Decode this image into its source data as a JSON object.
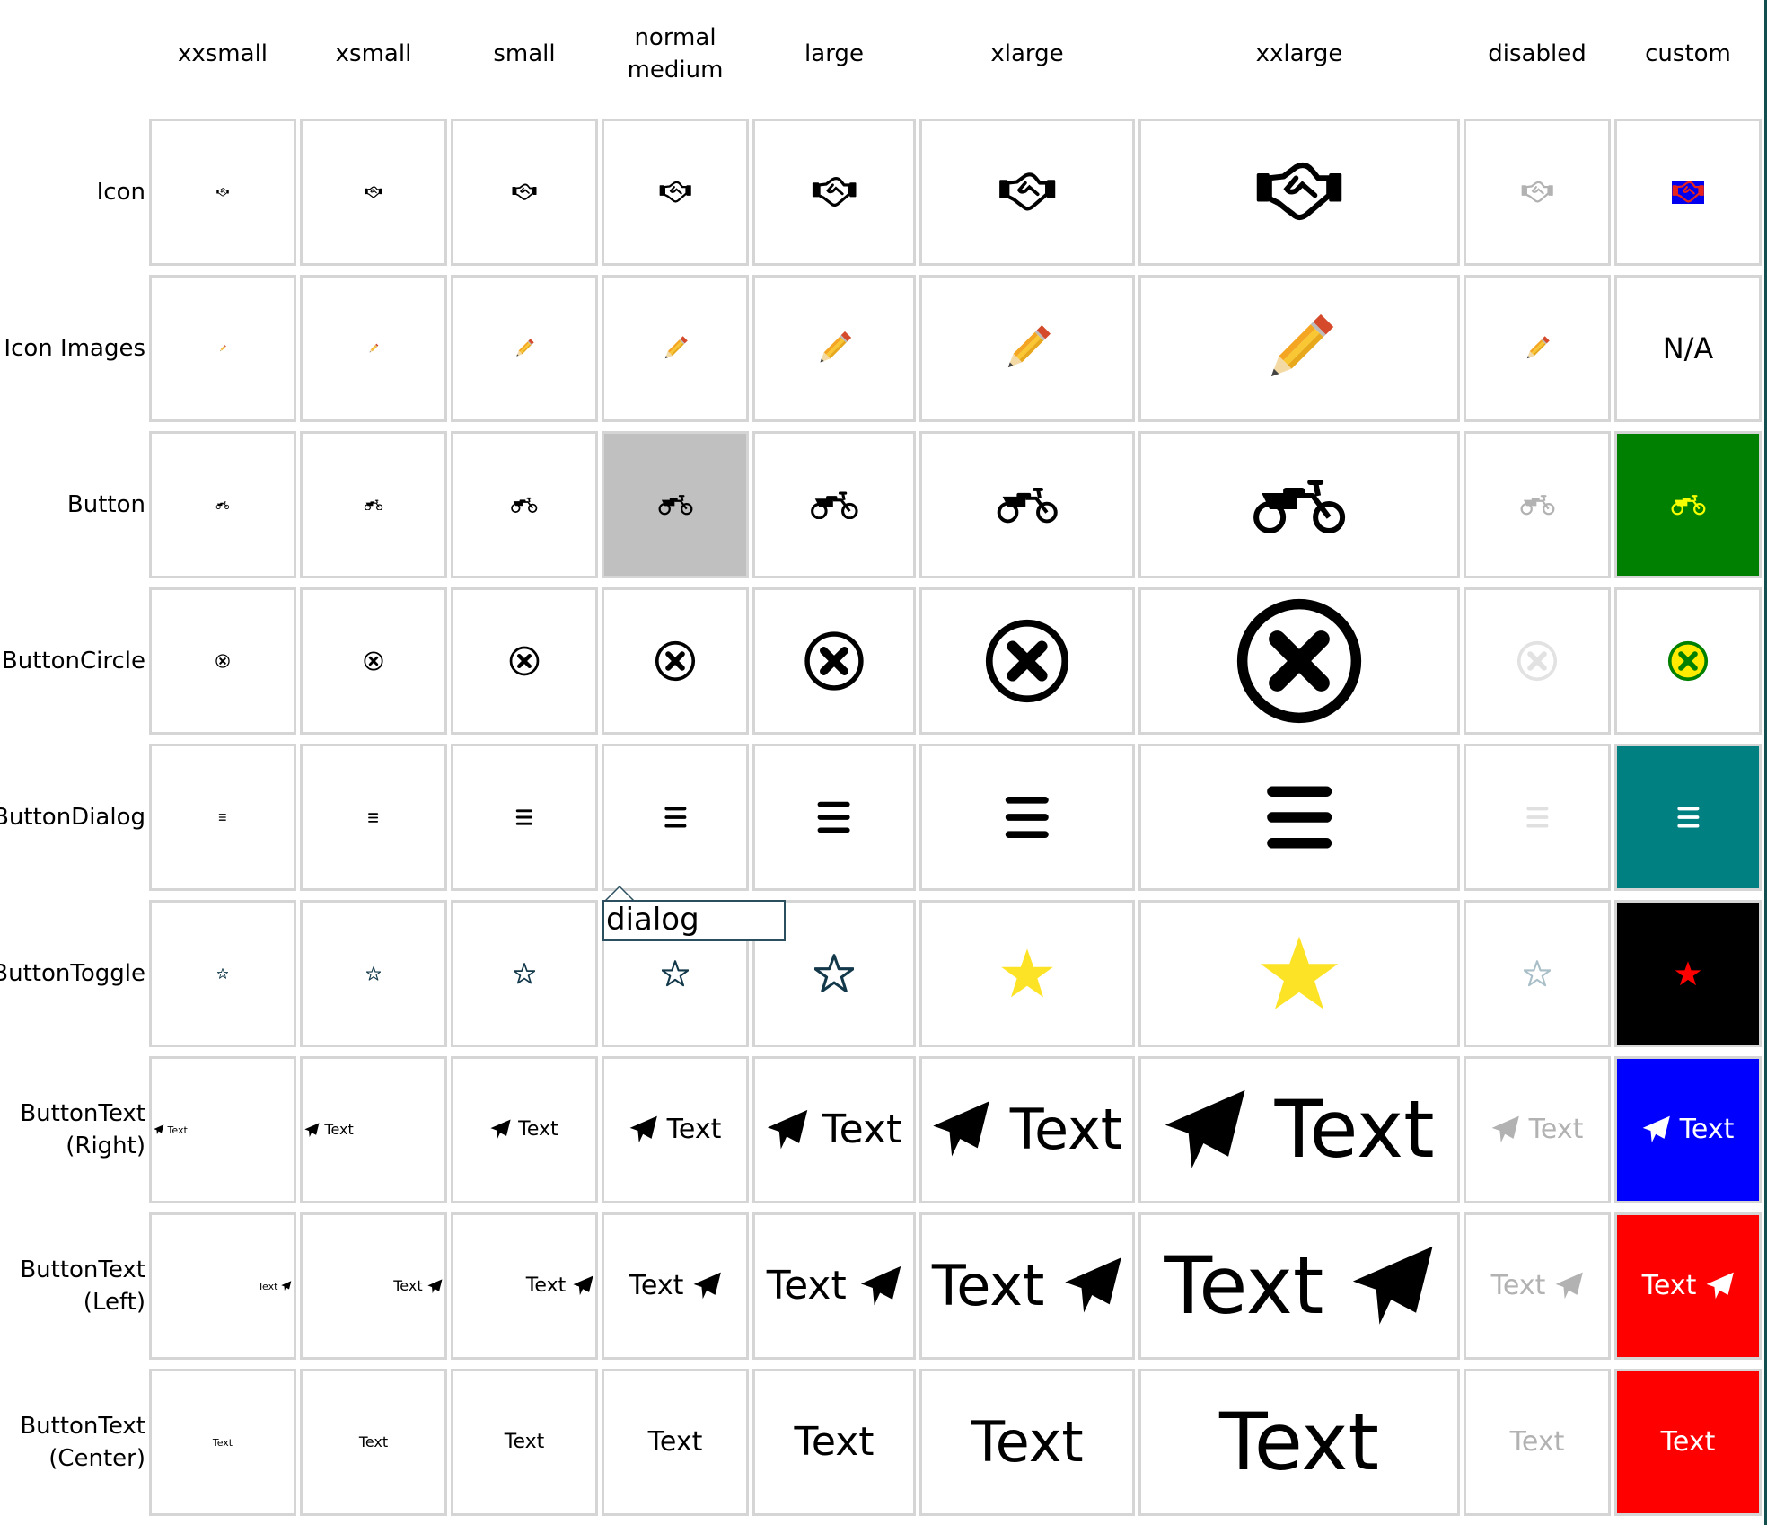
{
  "columns": [
    "xxsmall",
    "xsmall",
    "small",
    "normal\nmedium",
    "large",
    "xlarge",
    "xxlarge",
    "disabled",
    "custom"
  ],
  "rows": [
    "Icon",
    "Icon Images",
    "Button",
    "ButtonCircle",
    "ButtonDialog",
    "ButtonToggle",
    "ButtonText\n(Right)",
    "ButtonText\n(Left)",
    "ButtonText\n(Center)"
  ],
  "icon_names": {
    "Icon": "handshake-icon",
    "Icon Images": "pencil-icon",
    "Button": "motorcycle-icon",
    "ButtonCircle": "close-circle-icon",
    "ButtonDialog": "menu-icon",
    "ButtonToggle": "star-icon",
    "ButtonText": "paper-plane-icon"
  },
  "button_text_label": "Text",
  "na_label": "N/A",
  "tooltip": {
    "label": "dialog"
  },
  "colors": {
    "custom_icon_bg": "#0000ee",
    "custom_icon_fg": "#e8251d",
    "custom_button_bg": "#008000",
    "custom_button_fg": "#f6ff00",
    "custom_circle_fill": "#ffeb00",
    "custom_circle_stroke": "#008000",
    "custom_dialog_bg": "#008080",
    "custom_toggle_bg": "#000000",
    "custom_toggle_star": "#ff0000",
    "custom_text_right_bg": "#0000ff",
    "custom_text_left_bg": "#ff0000",
    "custom_text_center_bg": "#ff0000",
    "toggle_outline": "#12384a",
    "toggle_active": "#fde326",
    "disabled_gray": "#b2b2b2",
    "pressed_bg": "#c0c0c0",
    "pencil_yellow": "#f9c733",
    "pencil_eraser": "#d44a2a"
  }
}
